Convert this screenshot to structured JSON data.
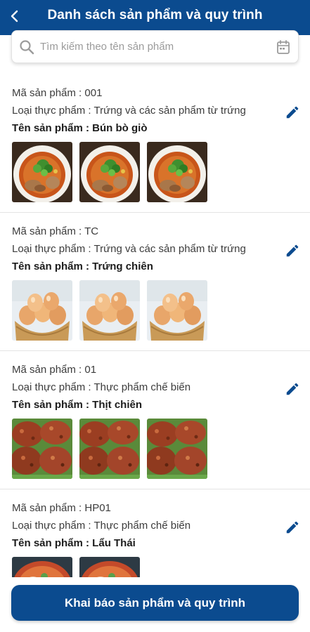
{
  "header": {
    "title": "Danh sách sản phẩm và quy trình",
    "back_icon": "chevron-left-icon"
  },
  "search": {
    "placeholder": "Tìm kiếm theo tên sản phẩm",
    "icon": "search-icon",
    "calendar_icon": "calendar-icon"
  },
  "products": [
    {
      "code": "Mã sản phẩm : 001",
      "category": "Loại thực phẩm : Trứng và các sản phẩm từ trứng",
      "name": "Tên sản phẩm : Bún bò giò",
      "image": "noodle-soup",
      "image_count": 3
    },
    {
      "code": "Mã sản phẩm : TC",
      "category": "Loại thực phẩm : Trứng và các sản phẩm từ trứng",
      "name": "Tên sản phẩm : Trứng chiên",
      "image": "eggs-basket",
      "image_count": 3
    },
    {
      "code": "Mã sản phẩm : 01",
      "category": "Loại thực phẩm : Thực phẩm chế biến",
      "name": "Tên sản phẩm : Thịt chiên",
      "image": "fried-meat",
      "image_count": 3
    },
    {
      "code": "Mã sản phẩm : HP01",
      "category": "Loại thực phẩm : Thực phẩm chế biến",
      "name": "Tên sản phẩm : Lẩu Thái",
      "image": "thai-hotpot",
      "image_count": 2
    }
  ],
  "footer": {
    "button_label": "Khai báo sản phẩm và quy trình"
  },
  "colors": {
    "primary": "#0b4b8f",
    "edit_icon": "#0b4b8f"
  }
}
